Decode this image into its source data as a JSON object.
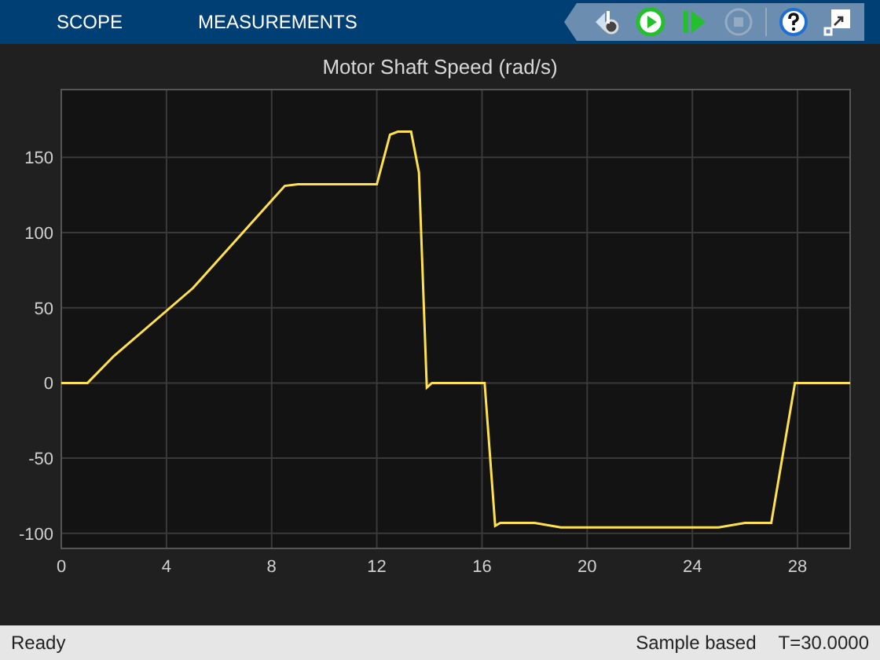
{
  "tabs": [
    {
      "label": "SCOPE"
    },
    {
      "label": "MEASUREMENTS"
    }
  ],
  "toolbar": [
    {
      "kind": "settings",
      "disabled": false
    },
    {
      "kind": "run",
      "disabled": false
    },
    {
      "kind": "step",
      "disabled": false
    },
    {
      "kind": "stop",
      "disabled": true
    },
    {
      "kind": "help",
      "disabled": false
    },
    {
      "kind": "undock",
      "disabled": false
    }
  ],
  "chart_data": {
    "type": "line",
    "title": "Motor Shaft Speed (rad/s)",
    "xlim": [
      0,
      30
    ],
    "ylim": [
      -110,
      195
    ],
    "xticks": [
      0,
      4,
      8,
      12,
      16,
      20,
      24,
      28
    ],
    "yticks": [
      -100,
      -50,
      0,
      50,
      100,
      150
    ],
    "x": [
      0,
      1,
      2,
      5,
      8.5,
      9,
      12,
      12.5,
      12.8,
      13.3,
      13.6,
      13.9,
      14.1,
      16.1,
      16.5,
      16.7,
      18,
      19,
      25,
      26,
      27,
      27.9,
      30
    ],
    "grid": true,
    "series": [
      {
        "color": "#ffe14d",
        "values": [
          0,
          0,
          18,
          63,
          131,
          132,
          132,
          165,
          167,
          167,
          140,
          -3,
          0,
          0,
          -95,
          -93,
          -93,
          -96,
          -96,
          -93,
          -93,
          0,
          0
        ]
      }
    ]
  },
  "status_bar": {
    "left": "Ready",
    "mode": "Sample based",
    "time": "T=30.0000"
  }
}
